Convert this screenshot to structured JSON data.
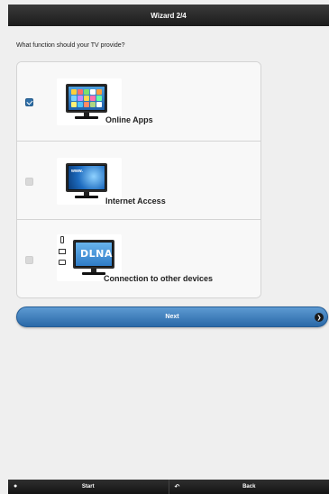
{
  "header": {
    "title": "Wizard 2/4"
  },
  "question": "What function should your TV provide?",
  "options": [
    {
      "label": "Online Apps",
      "checked": true,
      "icon": "tv-apps-icon"
    },
    {
      "label": "Internet Access",
      "checked": false,
      "icon": "tv-internet-icon"
    },
    {
      "label": "Connection to other devices",
      "checked": false,
      "icon": "tv-dlna-icon"
    }
  ],
  "dlna_text": "DLNA",
  "www_text": "www.",
  "next": {
    "label": "Next",
    "icon": "arrow-right-icon"
  },
  "footer": {
    "start": {
      "label": "Start",
      "icon": "home-icon"
    },
    "back": {
      "label": "Back",
      "icon": "back-icon"
    }
  },
  "colors": {
    "accent": "#2f6fa8",
    "header": "#1c1c1c"
  }
}
